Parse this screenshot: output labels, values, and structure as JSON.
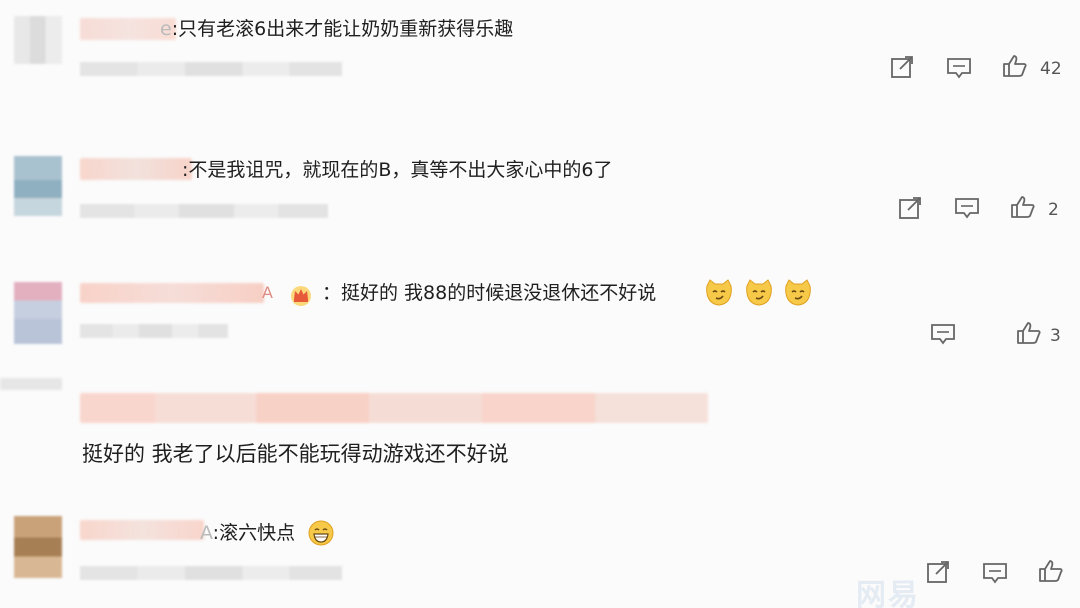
{
  "comments": [
    {
      "name_tail": "e",
      "text": ":只有老滚6出来才能让奶奶重新获得乐趣",
      "likes": "42",
      "actions": [
        "share-icon",
        "reply-icon",
        "like-icon"
      ]
    },
    {
      "name_tail": "",
      "text": ":不是我诅咒，就现在的B，真等不出大家心中的6了",
      "likes": "2",
      "actions": [
        "share-icon",
        "reply-icon",
        "like-icon"
      ]
    },
    {
      "name_tail": "A",
      "text": "：挺好的 我88的时候退没退休还不好说",
      "likes": "3",
      "badge": "crown-badge-icon",
      "emojis": [
        "smirk-cat-emoji",
        "smirk-cat-emoji",
        "smirk-cat-emoji"
      ],
      "actions": [
        "reply-icon",
        "like-icon"
      ]
    },
    {
      "quote_blurred": true,
      "text": "挺好的 我老了以后能不能玩得动游戏还不好说"
    },
    {
      "name_tail": "A",
      "text": ":滚六快点",
      "emoji": "grin-emoji",
      "actions": [
        "share-icon",
        "reply-icon",
        "like-icon"
      ]
    }
  ],
  "colors": {
    "name_blur": "#f6d6d0",
    "quote_blur": "#f8d8cf",
    "icon_stroke": "#666666",
    "emoji_yellow": "#f7c948"
  },
  "watermark": "网易"
}
